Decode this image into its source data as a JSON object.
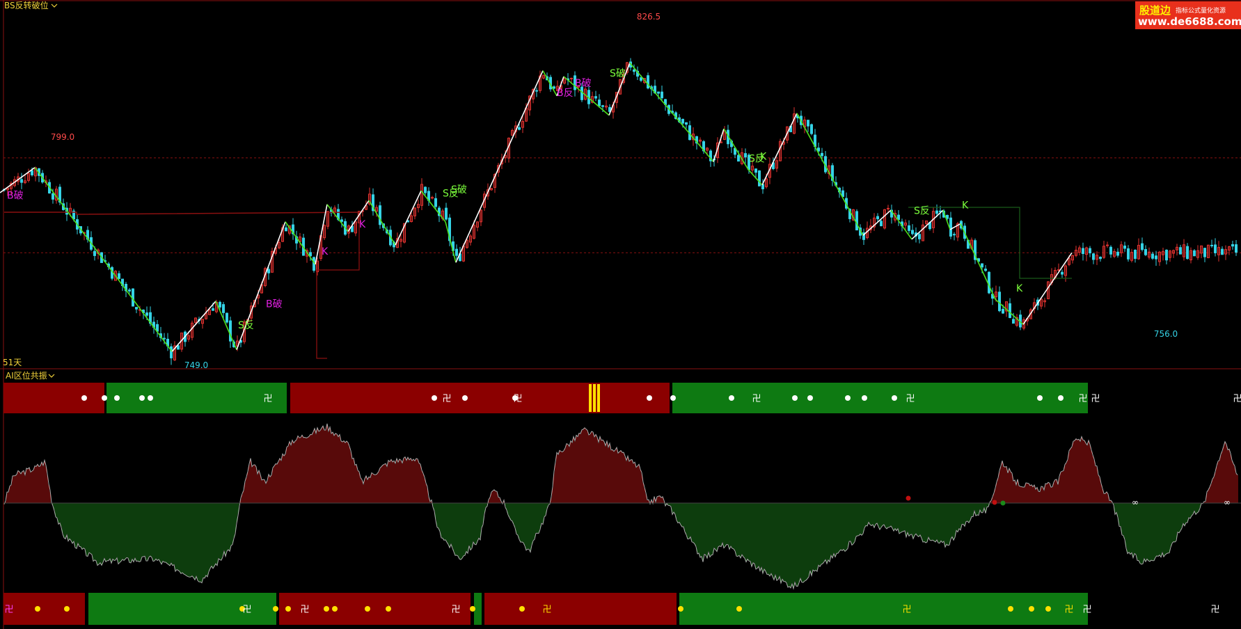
{
  "panels": {
    "main_title": "BS反转破位",
    "sub_title": "AI区位共振",
    "days_label": "51天"
  },
  "watermark": {
    "line1": "股道边",
    "line2": "指标公式量化资源",
    "line3": "www.de6688.com"
  },
  "colors": {
    "background": "#000000",
    "up_candle": "#e0322f",
    "down_candle": "#35d3e6",
    "zigzag_up": "#ffffff",
    "zigzag_down": "#4ce01a",
    "band_red": "#8b0000",
    "band_green": "#0e7a12",
    "hist_red": "#b01414",
    "hist_green": "#1a7a1a",
    "signal_magenta": "#e020e0",
    "signal_green": "#7cff3c",
    "dashed_line": "#8a1010",
    "axis_frame": "#8a1010"
  },
  "chart_data": {
    "type": "line",
    "title": "BS反转破位",
    "price_labels": {
      "high": "826.5",
      "left_high": "799.0",
      "low": "749.0",
      "right_low": "756.0"
    },
    "zigzag": {
      "x": [
        0,
        50,
        247,
        310,
        340,
        410,
        453,
        470,
        500,
        530,
        568,
        605,
        640,
        655,
        780,
        800,
        810,
        875,
        905,
        1025,
        1040,
        1075,
        1095,
        1145,
        1240,
        1280,
        1310,
        1355,
        1365,
        1380,
        1430,
        1470,
        1540
      ],
      "y": [
        790.0,
        796.5,
        749.0,
        762.0,
        749.5,
        782.5,
        771.5,
        787.0,
        780.0,
        788.0,
        776.5,
        790.5,
        782.5,
        772.0,
        821.5,
        815.0,
        820.0,
        810.0,
        823.5,
        798.0,
        806.5,
        796.0,
        792.0,
        810.5,
        779.0,
        785.5,
        778.0,
        785.5,
        780.5,
        782.0,
        762.5,
        756.0,
        774.5
      ]
    },
    "signals": [
      {
        "text": "B破",
        "x": 10,
        "y": 788.5,
        "color": "magenta"
      },
      {
        "text": "S反",
        "x": 342,
        "y": 755.0,
        "color": "green"
      },
      {
        "text": "B破",
        "x": 382,
        "y": 760.5,
        "color": "magenta"
      },
      {
        "text": "K",
        "x": 462,
        "y": 774.0,
        "color": "magenta"
      },
      {
        "text": "K",
        "x": 516,
        "y": 781.0,
        "color": "magenta"
      },
      {
        "text": "S反",
        "x": 636,
        "y": 789.0,
        "color": "green"
      },
      {
        "text": "S破",
        "x": 648,
        "y": 790.0,
        "color": "green"
      },
      {
        "text": "B反",
        "x": 800,
        "y": 815.0,
        "color": "magenta"
      },
      {
        "text": "B破",
        "x": 826,
        "y": 817.5,
        "color": "magenta"
      },
      {
        "text": "S破",
        "x": 876,
        "y": 820.0,
        "color": "green"
      },
      {
        "text": "S反",
        "x": 1076,
        "y": 798.0,
        "color": "green"
      },
      {
        "text": "K",
        "x": 1092,
        "y": 798.5,
        "color": "green"
      },
      {
        "text": "S反",
        "x": 1313,
        "y": 784.5,
        "color": "green"
      },
      {
        "text": "K",
        "x": 1382,
        "y": 786.0,
        "color": "green"
      },
      {
        "text": "K",
        "x": 1460,
        "y": 764.5,
        "color": "green"
      }
    ],
    "ylim": [
      746.0,
      834.0
    ],
    "grid": false,
    "reference_lines": [
      799.0,
      774.5
    ]
  },
  "bands": {
    "top": [
      {
        "x0": 5,
        "x1": 150,
        "color": "red"
      },
      {
        "x0": 153,
        "x1": 412,
        "color": "green"
      },
      {
        "x0": 417,
        "x1": 962,
        "color": "red"
      },
      {
        "x0": 966,
        "x1": 1563,
        "color": "green"
      }
    ],
    "bottom": [
      {
        "x0": 5,
        "x1": 122,
        "color": "red"
      },
      {
        "x0": 127,
        "x1": 397,
        "color": "green"
      },
      {
        "x0": 401,
        "x1": 676,
        "color": "red"
      },
      {
        "x0": 681,
        "x1": 692,
        "color": "green"
      },
      {
        "x0": 696,
        "x1": 972,
        "color": "red"
      },
      {
        "x0": 976,
        "x1": 1563,
        "color": "green"
      }
    ],
    "symbol": "卍"
  }
}
